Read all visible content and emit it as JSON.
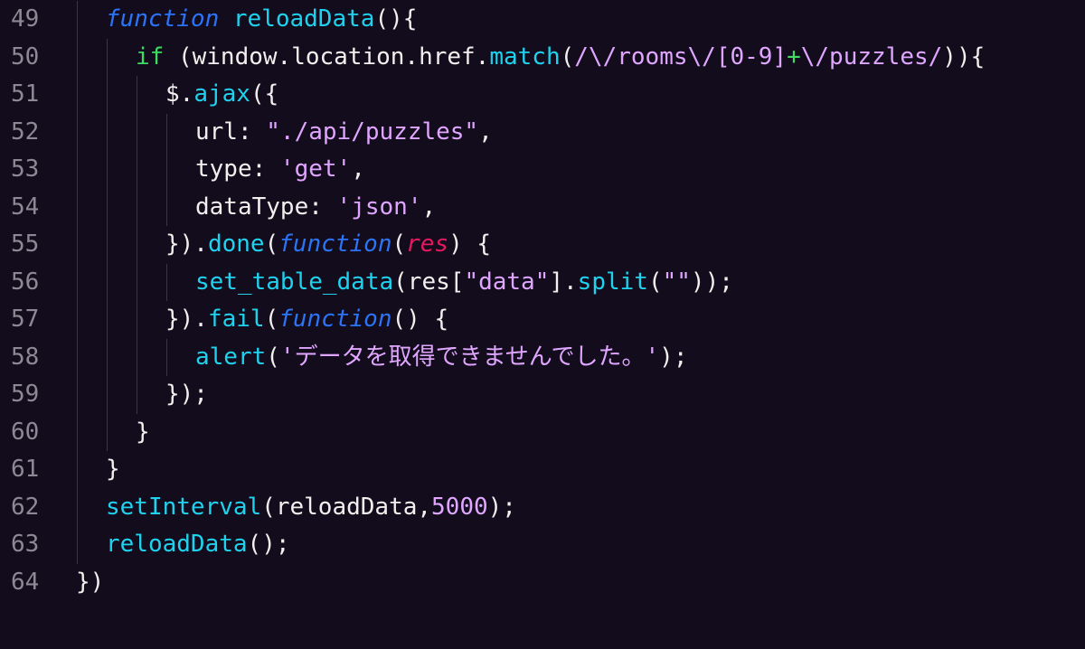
{
  "colors": {
    "background": "#130c1d",
    "line_number": "#8e8894",
    "keyword": "#2b74f6",
    "function_name": "#1fd2ee",
    "plain_text": "#f2f0ee",
    "string": "#e0a6ff",
    "parameter": "#e4195f",
    "if_keyword": "#3fdc62",
    "indent_guide": "#3b3545"
  },
  "editor": {
    "lines": [
      {
        "number": "49",
        "indent": 1,
        "tokens": [
          {
            "text": "function",
            "kind": "kw"
          },
          {
            "text": " ",
            "kind": "tx"
          },
          {
            "text": "reloadData",
            "kind": "fn"
          },
          {
            "text": "(){",
            "kind": "pu"
          }
        ]
      },
      {
        "number": "50",
        "indent": 2,
        "tokens": [
          {
            "text": "if",
            "kind": "gr"
          },
          {
            "text": " (window.location.href.",
            "kind": "tx"
          },
          {
            "text": "match",
            "kind": "fn"
          },
          {
            "text": "(",
            "kind": "pu"
          },
          {
            "text": "/\\/rooms\\/[0-9]",
            "kind": "rx"
          },
          {
            "text": "+",
            "kind": "gr"
          },
          {
            "text": "\\/puzzles/",
            "kind": "rx"
          },
          {
            "text": ")){",
            "kind": "pu"
          }
        ]
      },
      {
        "number": "51",
        "indent": 3,
        "tokens": [
          {
            "text": "$.",
            "kind": "tx"
          },
          {
            "text": "ajax",
            "kind": "fn"
          },
          {
            "text": "({",
            "kind": "pu"
          }
        ]
      },
      {
        "number": "52",
        "indent": 4,
        "tokens": [
          {
            "text": "url: ",
            "kind": "tx"
          },
          {
            "text": "\"./api/puzzles\"",
            "kind": "st"
          },
          {
            "text": ",",
            "kind": "pu"
          }
        ]
      },
      {
        "number": "53",
        "indent": 4,
        "tokens": [
          {
            "text": "type: ",
            "kind": "tx"
          },
          {
            "text": "'get'",
            "kind": "st"
          },
          {
            "text": ",",
            "kind": "pu"
          }
        ]
      },
      {
        "number": "54",
        "indent": 4,
        "tokens": [
          {
            "text": "dataType: ",
            "kind": "tx"
          },
          {
            "text": "'json'",
            "kind": "st"
          },
          {
            "text": ",",
            "kind": "pu"
          }
        ]
      },
      {
        "number": "55",
        "indent": 3,
        "tokens": [
          {
            "text": "}).",
            "kind": "pu"
          },
          {
            "text": "done",
            "kind": "fn"
          },
          {
            "text": "(",
            "kind": "pu"
          },
          {
            "text": "function",
            "kind": "kw"
          },
          {
            "text": "(",
            "kind": "pu"
          },
          {
            "text": "res",
            "kind": "pa"
          },
          {
            "text": ") {",
            "kind": "pu"
          }
        ]
      },
      {
        "number": "56",
        "indent": 4,
        "tokens": [
          {
            "text": "set_table_data",
            "kind": "fn"
          },
          {
            "text": "(res[",
            "kind": "pu"
          },
          {
            "text": "\"data\"",
            "kind": "st"
          },
          {
            "text": "].",
            "kind": "pu"
          },
          {
            "text": "split",
            "kind": "fn"
          },
          {
            "text": "(",
            "kind": "pu"
          },
          {
            "text": "\"\"",
            "kind": "st"
          },
          {
            "text": "));",
            "kind": "pu"
          }
        ]
      },
      {
        "number": "57",
        "indent": 3,
        "tokens": [
          {
            "text": "}).",
            "kind": "pu"
          },
          {
            "text": "fail",
            "kind": "fn"
          },
          {
            "text": "(",
            "kind": "pu"
          },
          {
            "text": "function",
            "kind": "kw"
          },
          {
            "text": "() {",
            "kind": "pu"
          }
        ]
      },
      {
        "number": "58",
        "indent": 4,
        "tokens": [
          {
            "text": "alert",
            "kind": "fn"
          },
          {
            "text": "(",
            "kind": "pu"
          },
          {
            "text": "'データを取得できませんでした。'",
            "kind": "st"
          },
          {
            "text": ");",
            "kind": "pu"
          }
        ]
      },
      {
        "number": "59",
        "indent": 3,
        "tokens": [
          {
            "text": "});",
            "kind": "pu"
          }
        ]
      },
      {
        "number": "60",
        "indent": 2,
        "tokens": [
          {
            "text": "}",
            "kind": "pu"
          }
        ]
      },
      {
        "number": "61",
        "indent": 1,
        "tokens": [
          {
            "text": "}",
            "kind": "pu"
          }
        ]
      },
      {
        "number": "62",
        "indent": 1,
        "tokens": [
          {
            "text": "setInterval",
            "kind": "fn"
          },
          {
            "text": "(reloadData,",
            "kind": "pu"
          },
          {
            "text": "5000",
            "kind": "nu"
          },
          {
            "text": ");",
            "kind": "pu"
          }
        ]
      },
      {
        "number": "63",
        "indent": 1,
        "tokens": [
          {
            "text": "reloadData",
            "kind": "fn"
          },
          {
            "text": "();",
            "kind": "pu"
          }
        ]
      },
      {
        "number": "64",
        "indent": 0,
        "tokens": [
          {
            "text": "})",
            "kind": "pu"
          }
        ]
      }
    ]
  }
}
